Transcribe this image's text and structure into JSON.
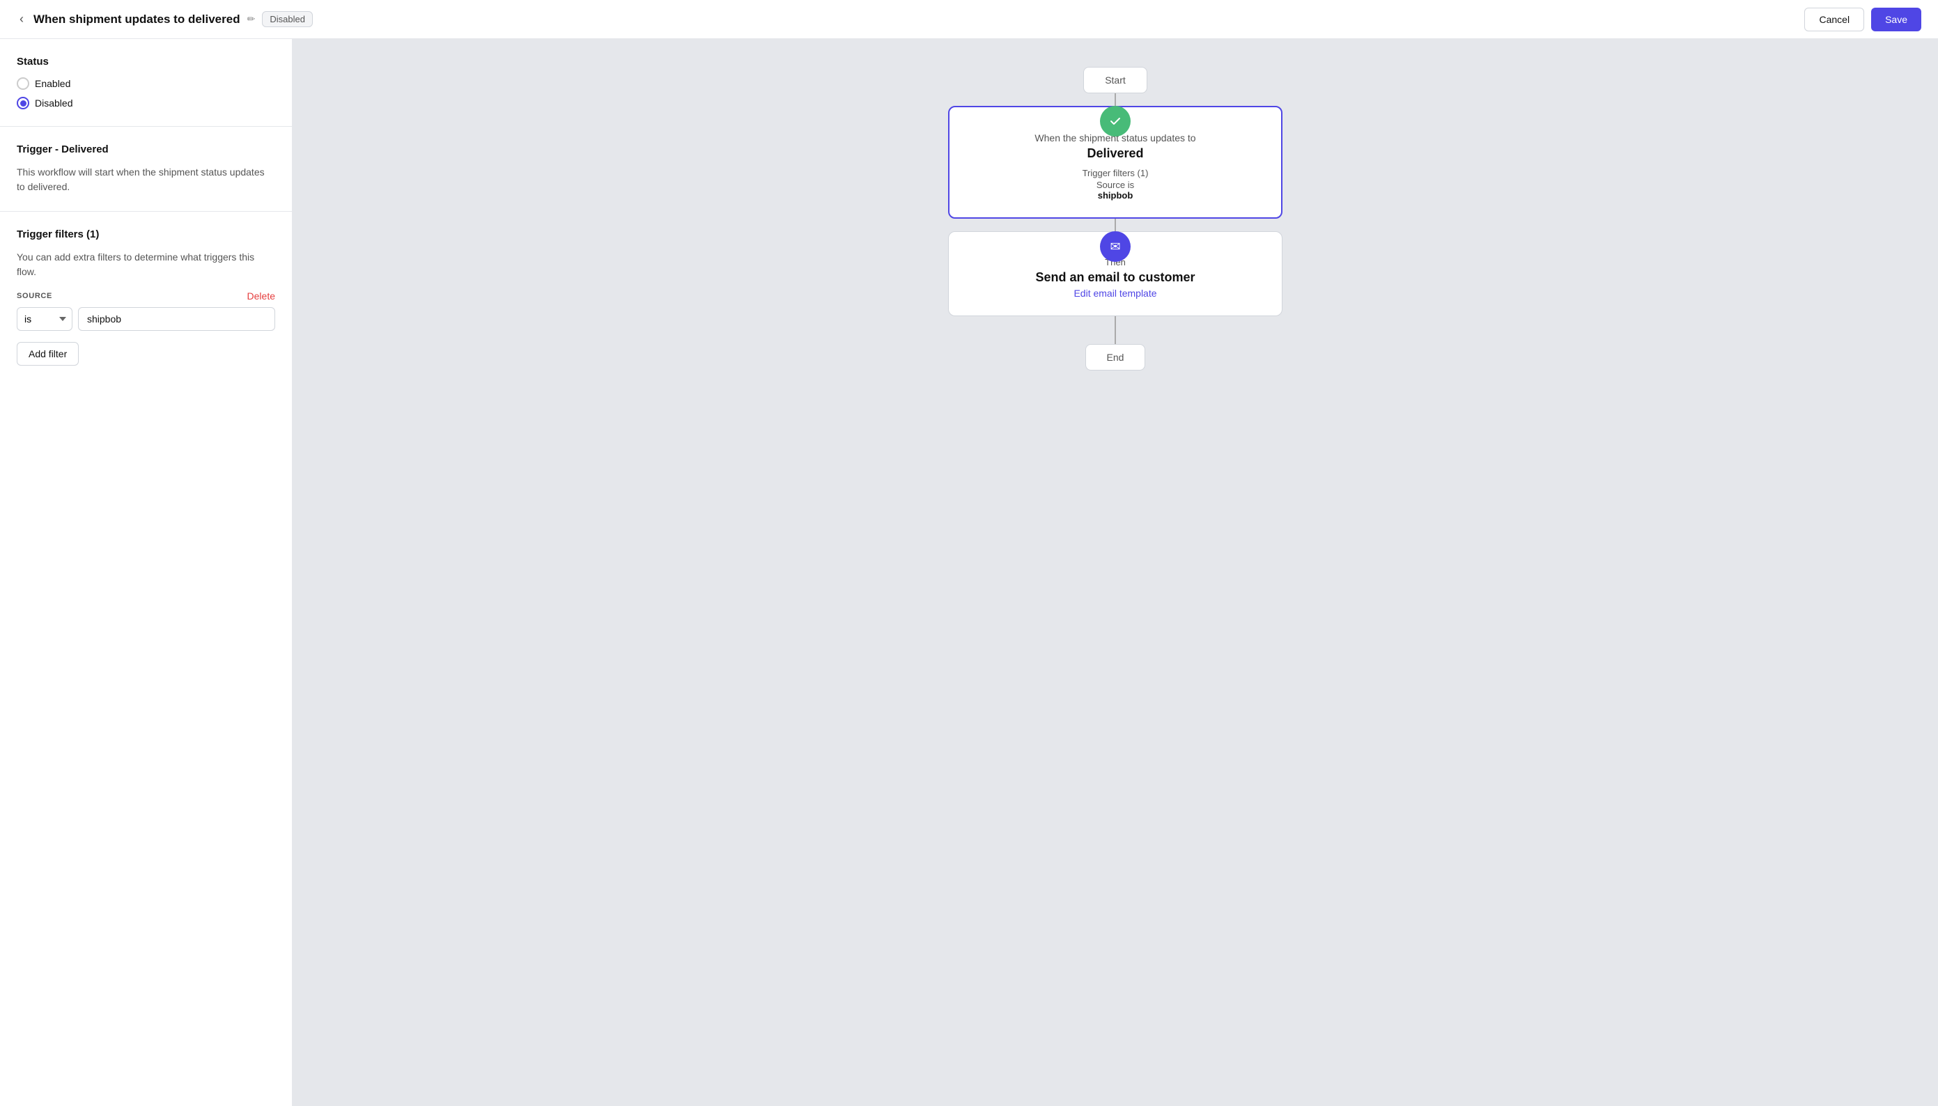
{
  "header": {
    "back_label": "‹",
    "title": "When shipment updates to delivered",
    "edit_icon": "✏",
    "badge": "Disabled",
    "cancel_label": "Cancel",
    "save_label": "Save"
  },
  "sidebar": {
    "status_section": {
      "title": "Status",
      "options": [
        {
          "label": "Enabled",
          "checked": false
        },
        {
          "label": "Disabled",
          "checked": true
        }
      ]
    },
    "trigger_section": {
      "title": "Trigger - Delivered",
      "description": "This workflow will start when the shipment status updates to delivered."
    },
    "filters_section": {
      "title": "Trigger filters (1)",
      "description": "You can add extra filters to determine what triggers this flow.",
      "filter_label": "SOURCE",
      "delete_label": "Delete",
      "filter_operator": "is",
      "filter_value": "shipbob",
      "add_filter_label": "Add filter"
    }
  },
  "canvas": {
    "start_label": "Start",
    "end_label": "End",
    "trigger_node": {
      "pre_text": "When the shipment status updates to",
      "status": "Delivered",
      "filters_title": "Trigger filters (1)",
      "source_label": "Source is",
      "source_value": "shipbob"
    },
    "action_node": {
      "then_label": "Then",
      "title": "Send an email to customer",
      "link_label": "Edit email template"
    }
  }
}
